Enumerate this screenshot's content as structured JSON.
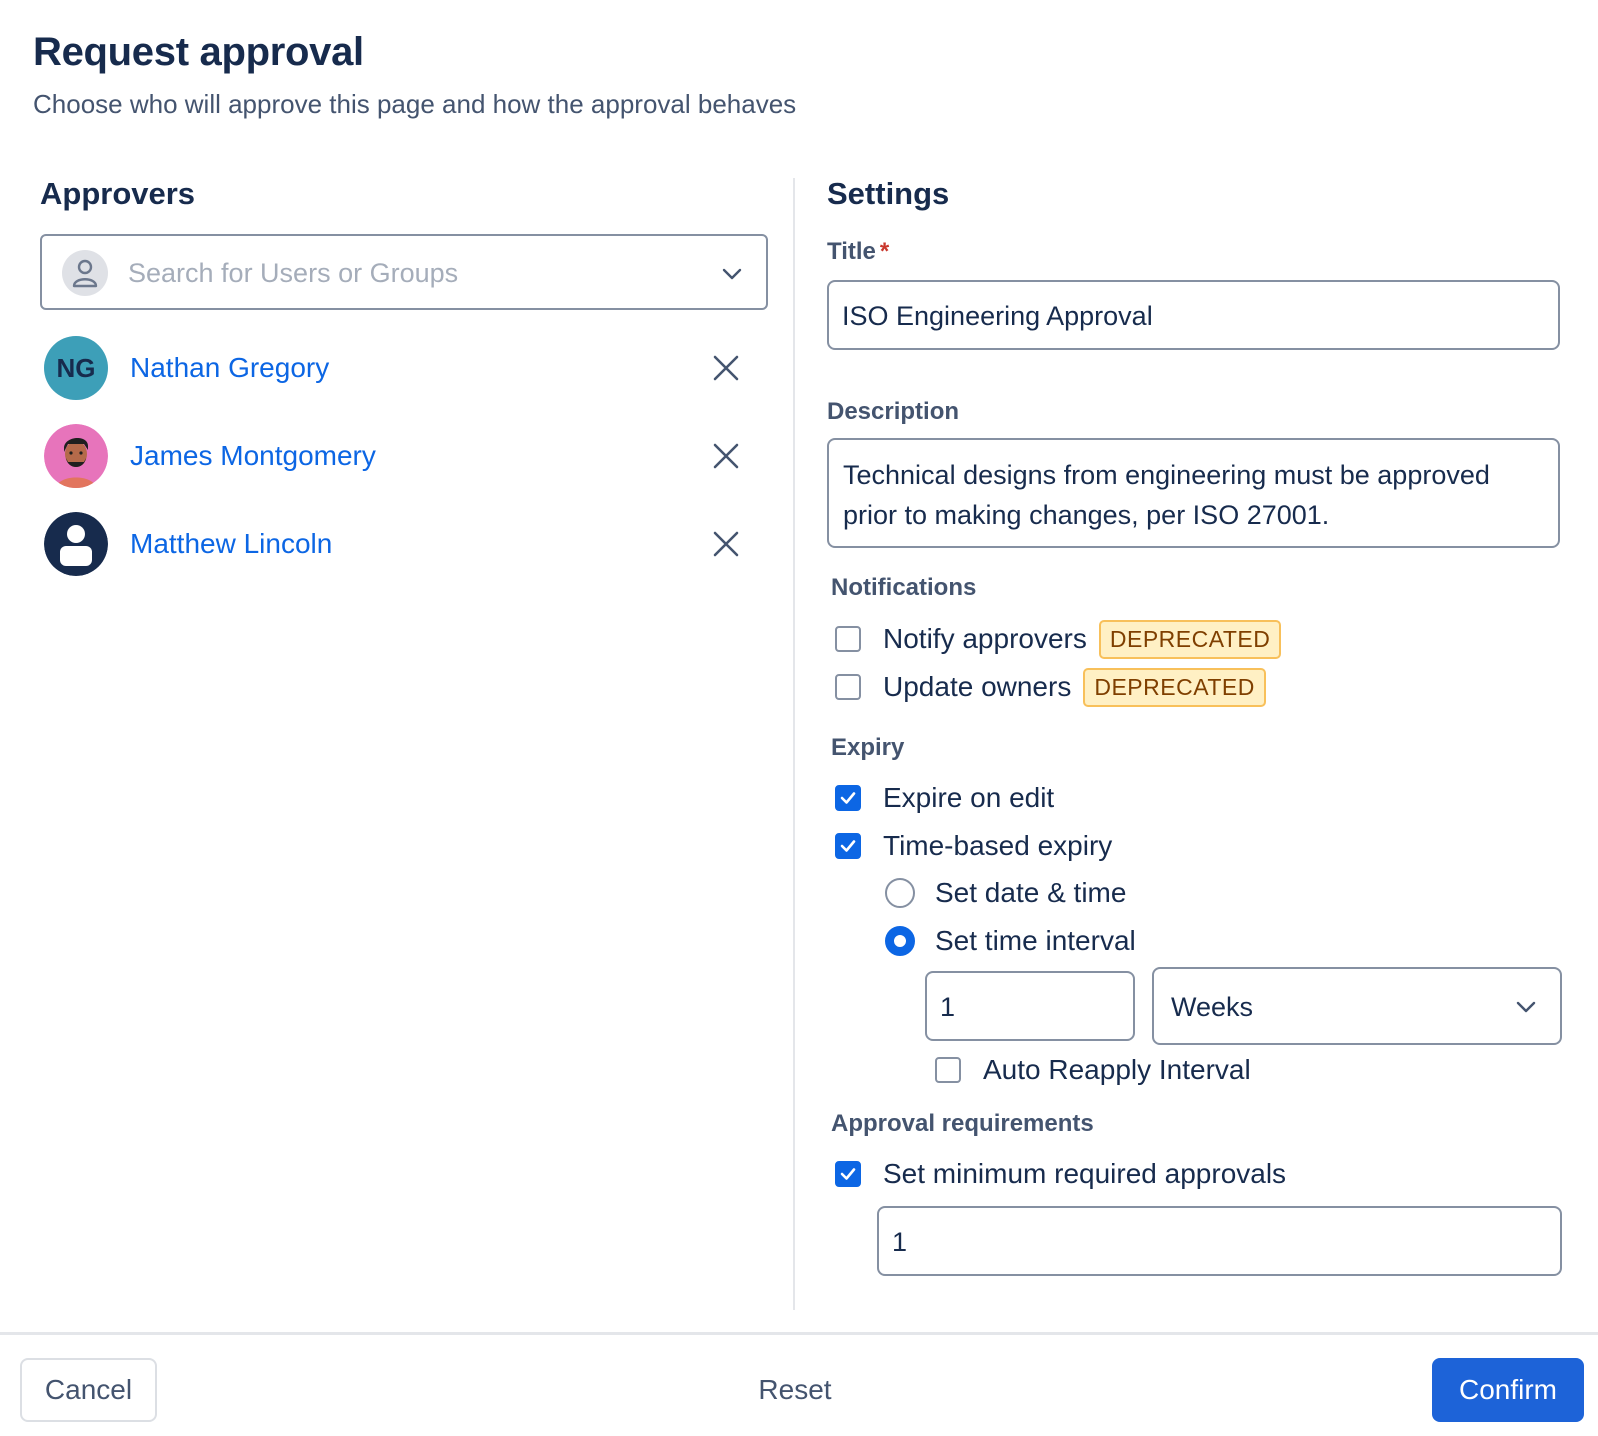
{
  "dialog": {
    "title": "Request approval",
    "subtitle": "Choose who will approve this page and how the approval behaves"
  },
  "approvers": {
    "heading": "Approvers",
    "search_placeholder": "Search for Users or Groups",
    "list": [
      {
        "name": "Nathan Gregory",
        "initials": "NG"
      },
      {
        "name": "James Montgomery"
      },
      {
        "name": "Matthew Lincoln"
      }
    ]
  },
  "settings": {
    "heading": "Settings",
    "title_label": "Title",
    "required_mark": "*",
    "title_value": "ISO Engineering Approval",
    "description_label": "Description",
    "description_value": "Technical designs from engineering must be approved prior to making changes, per ISO 27001.",
    "notifications": {
      "heading": "Notifications",
      "notify_approvers": {
        "label": "Notify approvers",
        "badge": "DEPRECATED",
        "checked": false
      },
      "update_owners": {
        "label": "Update owners",
        "badge": "DEPRECATED",
        "checked": false
      }
    },
    "expiry": {
      "heading": "Expiry",
      "expire_on_edit": {
        "label": "Expire on edit",
        "checked": true
      },
      "time_based": {
        "label": "Time-based expiry",
        "checked": true
      },
      "set_date_time": {
        "label": "Set date & time",
        "selected": false
      },
      "set_time_interval": {
        "label": "Set time interval",
        "selected": true
      },
      "interval_value": "1",
      "interval_unit": "Weeks",
      "auto_reapply": {
        "label": "Auto Reapply Interval",
        "checked": false
      }
    },
    "approval_requirements": {
      "heading": "Approval requirements",
      "set_minimum": {
        "label": "Set minimum required approvals",
        "checked": true
      },
      "minimum_value": "1"
    }
  },
  "footer": {
    "cancel_label": "Cancel",
    "reset_label": "Reset",
    "confirm_label": "Confirm"
  },
  "colors": {
    "accent": "#0c66e4",
    "confirm_bg": "#1d63d8",
    "badge_bg": "#fff0c4",
    "badge_border": "#f8c05a"
  }
}
